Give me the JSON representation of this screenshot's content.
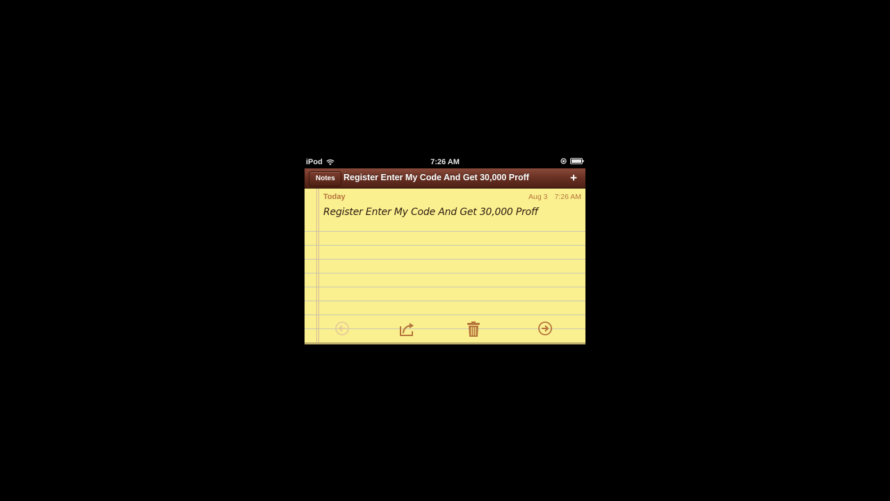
{
  "status_bar": {
    "carrier": "iPod",
    "time": "7:26 AM"
  },
  "nav": {
    "back_label": "Notes",
    "title": "Register Enter My Code And Get 30,000 Proff",
    "add_label": "+"
  },
  "note": {
    "day_label": "Today",
    "date": "Aug 3",
    "time": "7:26 AM",
    "body": "Register Enter My Code And Get 30,000 Proff"
  },
  "toolbar": {
    "icons": [
      "previous-arrow-icon",
      "share-icon",
      "trash-icon",
      "next-arrow-icon"
    ]
  },
  "colors": {
    "paper": "#fbf08f",
    "nav_bar": "#6a3224",
    "accent_text": "#b5743c",
    "toolbar_icon": "#b5743c"
  }
}
